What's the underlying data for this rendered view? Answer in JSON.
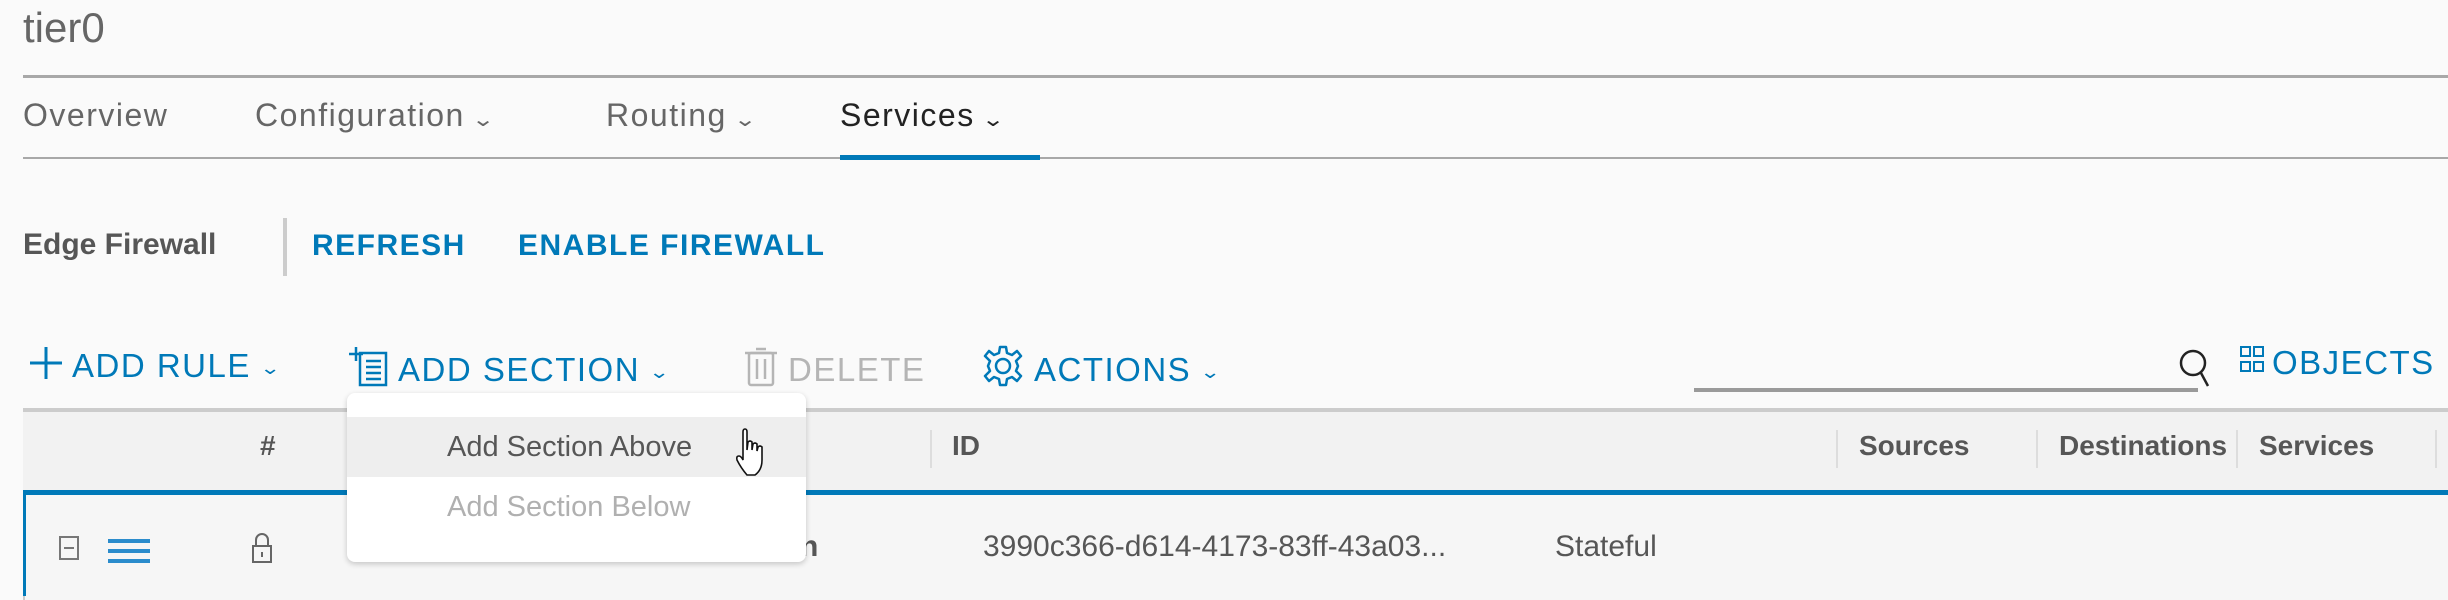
{
  "header": {
    "title": "tier0"
  },
  "tabs": [
    {
      "label": "Overview",
      "has_dropdown": false
    },
    {
      "label": "Configuration",
      "has_dropdown": true
    },
    {
      "label": "Routing",
      "has_dropdown": true
    },
    {
      "label": "Services",
      "has_dropdown": true,
      "active": true
    }
  ],
  "chevron": "⌄",
  "section": {
    "title": "Edge Firewall",
    "refresh": "REFRESH",
    "enable": "ENABLE FIREWALL"
  },
  "toolbar": {
    "add_rule": "ADD RULE",
    "add_section": "ADD SECTION",
    "delete": "DELETE",
    "actions": "ACTIONS",
    "objects": "OBJECTS",
    "search_value": ""
  },
  "dropdown": {
    "items": [
      {
        "label": "Add Section Above",
        "state": "hover"
      },
      {
        "label": "Add Section Below",
        "state": "disabled"
      }
    ]
  },
  "table": {
    "columns": [
      "#",
      "ID",
      "Sources",
      "Destinations",
      "Services"
    ],
    "rows": [
      {
        "name_visible": "n",
        "id": "3990c366-d614-4173-83ff-43a03...",
        "type": "Stateful"
      }
    ]
  },
  "colors": {
    "accent": "#0079b8",
    "text": "#565656",
    "disabled": "#b5b5b5"
  }
}
